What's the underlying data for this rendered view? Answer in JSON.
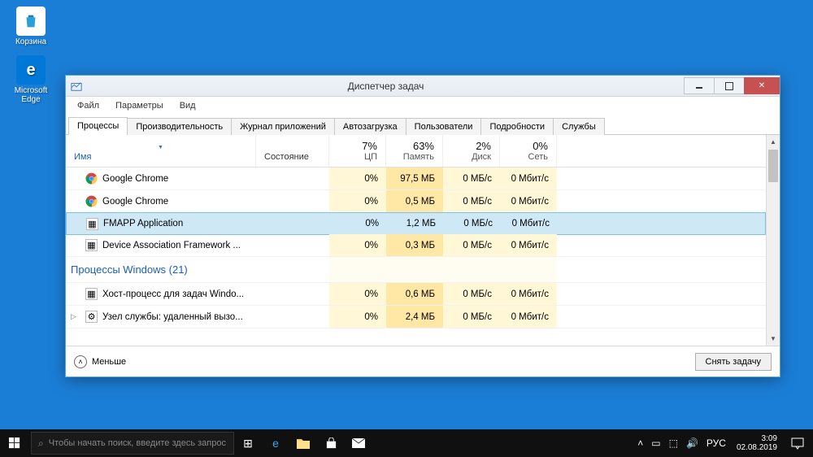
{
  "desktop": {
    "recycle_label": "Корзина",
    "edge_label": "Microsoft Edge"
  },
  "taskbar": {
    "search_placeholder": "Чтобы начать поиск, введите здесь запрос",
    "lang": "РУС",
    "time": "3:09",
    "date": "02.08.2019"
  },
  "window": {
    "title": "Диспетчер задач",
    "menu": {
      "file": "Файл",
      "options": "Параметры",
      "view": "Вид"
    },
    "tabs": {
      "processes": "Процессы",
      "performance": "Производительность",
      "app_history": "Журнал приложений",
      "startup": "Автозагрузка",
      "users": "Пользователи",
      "details": "Подробности",
      "services": "Службы"
    },
    "columns": {
      "name": "Имя",
      "state": "Состояние",
      "cpu_pct": "7%",
      "cpu": "ЦП",
      "mem_pct": "63%",
      "mem": "Память",
      "disk_pct": "2%",
      "disk": "Диск",
      "net_pct": "0%",
      "net": "Сеть"
    },
    "rows": [
      {
        "icon": "chrome",
        "name": "Google Chrome",
        "cpu": "0%",
        "mem": "97,5 МБ",
        "disk": "0 МБ/с",
        "net": "0 Мбит/с"
      },
      {
        "icon": "chrome",
        "name": "Google Chrome",
        "cpu": "0%",
        "mem": "0,5 МБ",
        "disk": "0 МБ/с",
        "net": "0 Мбит/с"
      },
      {
        "icon": "app",
        "name": "FMAPP Application",
        "cpu": "0%",
        "mem": "1,2 МБ",
        "disk": "0 МБ/с",
        "net": "0 Мбит/с",
        "selected": true
      },
      {
        "icon": "app",
        "name": "Device Association Framework ...",
        "cpu": "0%",
        "mem": "0,3 МБ",
        "disk": "0 МБ/с",
        "net": "0 Мбит/с"
      }
    ],
    "group_label": "Процессы Windows (21)",
    "rows2": [
      {
        "icon": "app",
        "name": "Хост-процесс для задач Windo...",
        "cpu": "0%",
        "mem": "0,6 МБ",
        "disk": "0 МБ/с",
        "net": "0 Мбит/с"
      },
      {
        "icon": "svc",
        "name": "Узел службы: удаленный вызо...",
        "cpu": "0%",
        "mem": "2,4 МБ",
        "disk": "0 МБ/с",
        "net": "0 Мбит/с",
        "expand": true
      }
    ],
    "footer": {
      "fewer": "Меньше",
      "end_task": "Снять задачу"
    }
  }
}
